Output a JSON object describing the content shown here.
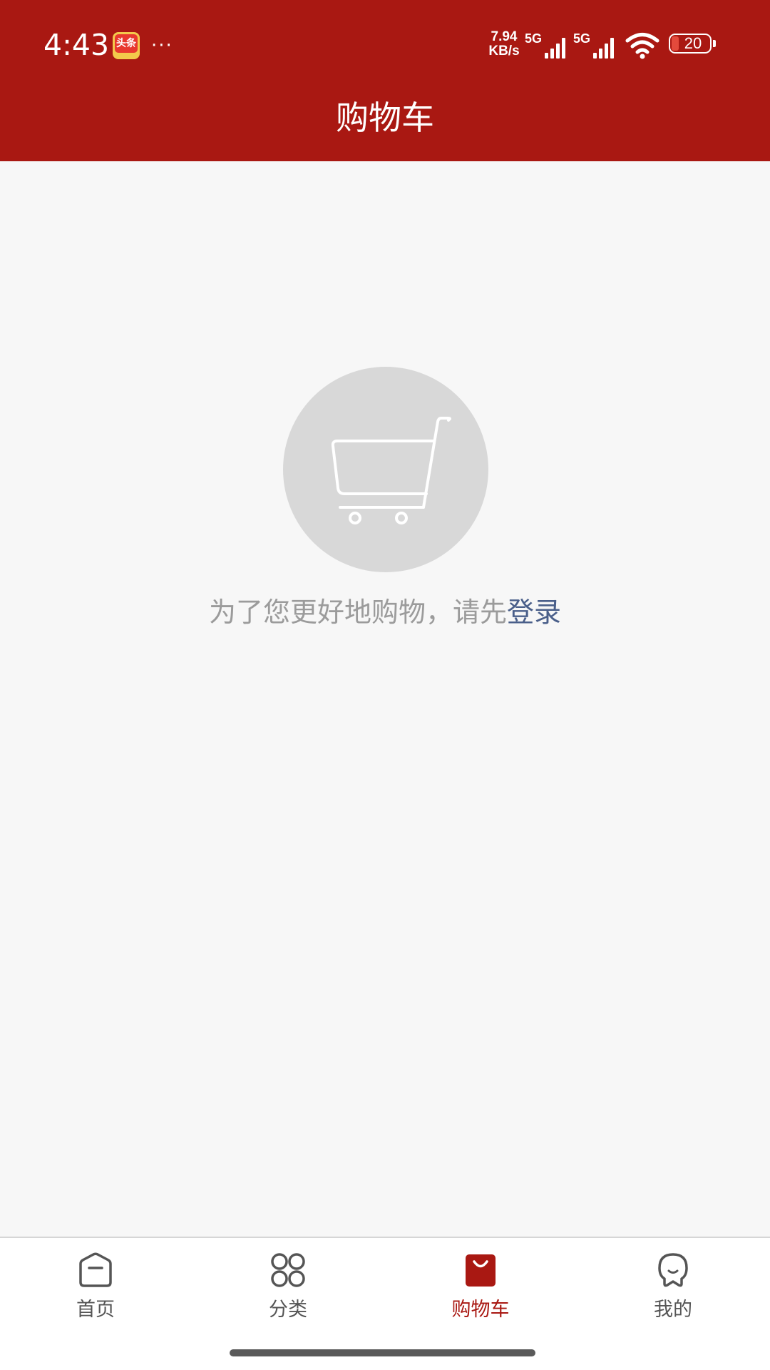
{
  "status_bar": {
    "time": "4:43",
    "app_icon_text": "头条",
    "more_dots": "···",
    "net_speed_value": "7.94",
    "net_speed_unit": "KB/s",
    "signal_1_label": "5G",
    "signal_2_label": "5G",
    "battery_level": "20",
    "icons": [
      "app-notification-icon",
      "network-speed",
      "signal-5g-icon",
      "signal-5g-icon",
      "wifi-icon",
      "battery-icon"
    ]
  },
  "header": {
    "title": "购物车"
  },
  "empty_state": {
    "icon": "shopping-cart-icon",
    "prompt_text": "为了您更好地购物，请先",
    "login_link_text": "登录"
  },
  "tab_bar": {
    "active_index": 2,
    "items": [
      {
        "label": "首页",
        "icon": "home-icon"
      },
      {
        "label": "分类",
        "icon": "category-icon"
      },
      {
        "label": "购物车",
        "icon": "shopping-bag-icon"
      },
      {
        "label": "我的",
        "icon": "profile-icon"
      }
    ]
  },
  "colors": {
    "brand_red": "#a91812",
    "background": "#f7f7f7",
    "link_blue": "#4a5f8a",
    "muted_text": "#9b9b9b"
  }
}
